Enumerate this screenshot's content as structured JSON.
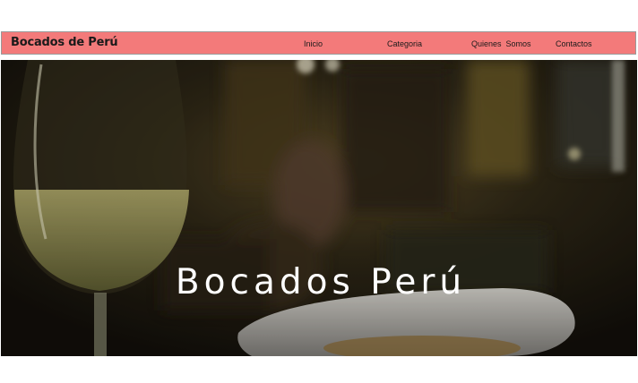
{
  "header": {
    "brand": "Bocados de Perú",
    "nav": [
      {
        "label": "Inicio"
      },
      {
        "label": "Categoria"
      },
      {
        "label": "Quienes  Somos"
      },
      {
        "label": "Contactos"
      }
    ]
  },
  "hero": {
    "title": "Bocados Perú",
    "image_description_icon": "restaurant-photo"
  },
  "colors": {
    "navbar": "#f37a7a",
    "text": "#1a1a1a",
    "hero_text": "#ffffff"
  }
}
